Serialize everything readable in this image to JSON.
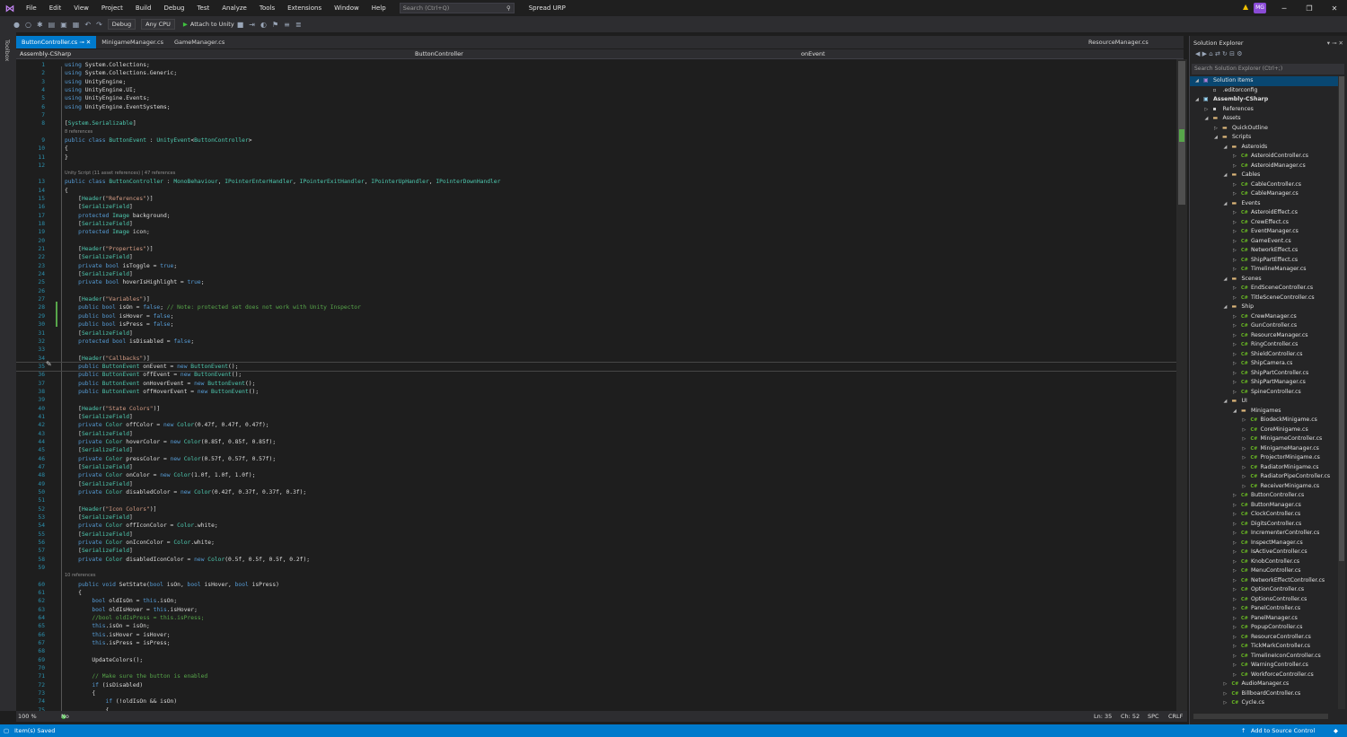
{
  "menubar": {
    "items": [
      "File",
      "Edit",
      "View",
      "Project",
      "Build",
      "Debug",
      "Test",
      "Analyze",
      "Tools",
      "Extensions",
      "Window",
      "Help"
    ],
    "search_placeholder": "Search (Ctrl+Q)",
    "solution_name": "Spread URP",
    "user_initials": "MG"
  },
  "toolbar": {
    "config": "Debug",
    "platform": "Any CPU",
    "attach_label": "Attach to Unity"
  },
  "left_strip": {
    "toolbox_label": "Toolbox"
  },
  "tabs": [
    {
      "label": "ButtonController.cs",
      "pin": "⊸",
      "close": "✕",
      "active": true
    },
    {
      "label": "MinigameManager.cs",
      "pin": "",
      "close": "",
      "active": false
    },
    {
      "label": "GameManager.cs",
      "pin": "",
      "close": "",
      "active": false
    }
  ],
  "tab_right": {
    "label": "ResourceManager.cs"
  },
  "navbar": {
    "project": "Assembly-CSharp",
    "class": "ButtonController",
    "member": "onEvent"
  },
  "code": [
    {
      "n": "1",
      "t": "using System.Collections;"
    },
    {
      "n": "2",
      "t": "using System.Collections.Generic;"
    },
    {
      "n": "3",
      "t": "using UnityEngine;"
    },
    {
      "n": "4",
      "t": "using UnityEngine.UI;"
    },
    {
      "n": "5",
      "t": "using UnityEngine.Events;"
    },
    {
      "n": "6",
      "t": "using UnityEngine.EventSystems;"
    },
    {
      "n": "7",
      "t": ""
    },
    {
      "n": "8",
      "t": "[System.Serializable]"
    },
    {
      "anno": "8 references"
    },
    {
      "n": "9",
      "t": "public class ButtonEvent : UnityEvent<ButtonController>"
    },
    {
      "n": "10",
      "t": "{"
    },
    {
      "n": "11",
      "t": "}"
    },
    {
      "n": "12",
      "t": ""
    },
    {
      "anno": "Unity Script (11 asset references) | 47 references"
    },
    {
      "n": "13",
      "t": "public class ButtonController : MonoBehaviour, IPointerEnterHandler, IPointerExitHandler, IPointerUpHandler, IPointerDownHandler"
    },
    {
      "n": "14",
      "t": "{"
    },
    {
      "n": "15",
      "t": "    [Header(\"References\")]"
    },
    {
      "n": "16",
      "t": "    [SerializeField]"
    },
    {
      "n": "17",
      "t": "    protected Image background;"
    },
    {
      "n": "18",
      "t": "    [SerializeField]"
    },
    {
      "n": "19",
      "t": "    protected Image icon;"
    },
    {
      "n": "20",
      "t": ""
    },
    {
      "n": "21",
      "t": "    [Header(\"Properties\")]"
    },
    {
      "n": "22",
      "t": "    [SerializeField]"
    },
    {
      "n": "23",
      "t": "    private bool isToggle = true;"
    },
    {
      "n": "24",
      "t": "    [SerializeField]"
    },
    {
      "n": "25",
      "t": "    private bool hoverIsHighlight = true;"
    },
    {
      "n": "26",
      "t": ""
    },
    {
      "n": "27",
      "t": "    [Header(\"Variables\")]"
    },
    {
      "n": "28",
      "t": "    public bool isOn = false; // Note: protected set does not work with Unity Inspector"
    },
    {
      "n": "29",
      "t": "    public bool isHover = false;"
    },
    {
      "n": "30",
      "t": "    public bool isPress = false;"
    },
    {
      "n": "31",
      "t": "    [SerializeField]"
    },
    {
      "n": "32",
      "t": "    protected bool isDisabled = false;"
    },
    {
      "n": "33",
      "t": ""
    },
    {
      "n": "34",
      "t": "    [Header(\"Callbacks\")]"
    },
    {
      "n": "35",
      "t": "    public ButtonEvent onEvent = new ButtonEvent();",
      "cur": true
    },
    {
      "n": "36",
      "t": "    public ButtonEvent offEvent = new ButtonEvent();"
    },
    {
      "n": "37",
      "t": "    public ButtonEvent onHoverEvent = new ButtonEvent();"
    },
    {
      "n": "38",
      "t": "    public ButtonEvent offHoverEvent = new ButtonEvent();"
    },
    {
      "n": "39",
      "t": ""
    },
    {
      "n": "40",
      "t": "    [Header(\"State Colors\")]"
    },
    {
      "n": "41",
      "t": "    [SerializeField]"
    },
    {
      "n": "42",
      "t": "    private Color offColor = new Color(0.47f, 0.47f, 0.47f);"
    },
    {
      "n": "43",
      "t": "    [SerializeField]"
    },
    {
      "n": "44",
      "t": "    private Color hoverColor = new Color(0.85f, 0.85f, 0.85f);"
    },
    {
      "n": "45",
      "t": "    [SerializeField]"
    },
    {
      "n": "46",
      "t": "    private Color pressColor = new Color(0.57f, 0.57f, 0.57f);"
    },
    {
      "n": "47",
      "t": "    [SerializeField]"
    },
    {
      "n": "48",
      "t": "    private Color onColor = new Color(1.0f, 1.0f, 1.0f);"
    },
    {
      "n": "49",
      "t": "    [SerializeField]"
    },
    {
      "n": "50",
      "t": "    private Color disabledColor = new Color(0.42f, 0.37f, 0.37f, 0.3f);"
    },
    {
      "n": "51",
      "t": ""
    },
    {
      "n": "52",
      "t": "    [Header(\"Icon Colors\")]"
    },
    {
      "n": "53",
      "t": "    [SerializeField]"
    },
    {
      "n": "54",
      "t": "    private Color offIconColor = Color.white;"
    },
    {
      "n": "55",
      "t": "    [SerializeField]"
    },
    {
      "n": "56",
      "t": "    private Color onIconColor = Color.white;"
    },
    {
      "n": "57",
      "t": "    [SerializeField]"
    },
    {
      "n": "58",
      "t": "    private Color disabledIconColor = new Color(0.5f, 0.5f, 0.5f, 0.2f);"
    },
    {
      "n": "59",
      "t": ""
    },
    {
      "anno": "10 references"
    },
    {
      "n": "60",
      "t": "    public void SetState(bool isOn, bool isHover, bool isPress)"
    },
    {
      "n": "61",
      "t": "    {"
    },
    {
      "n": "62",
      "t": "        bool oldIsOn = this.isOn;"
    },
    {
      "n": "63",
      "t": "        bool oldIsHover = this.isHover;"
    },
    {
      "n": "64",
      "t": "        //bool oldIsPress = this.isPress;"
    },
    {
      "n": "65",
      "t": "        this.isOn = isOn;"
    },
    {
      "n": "66",
      "t": "        this.isHover = isHover;"
    },
    {
      "n": "67",
      "t": "        this.isPress = isPress;"
    },
    {
      "n": "68",
      "t": ""
    },
    {
      "n": "69",
      "t": "        UpdateColors();"
    },
    {
      "n": "70",
      "t": ""
    },
    {
      "n": "71",
      "t": "        // Make sure the button is enabled"
    },
    {
      "n": "72",
      "t": "        if (isDisabled)"
    },
    {
      "n": "73",
      "t": "        {"
    },
    {
      "n": "74",
      "t": "            if (!oldIsOn && isOn)"
    },
    {
      "n": "75",
      "t": "            {"
    }
  ],
  "editor_status": {
    "zoom": "100 %",
    "issues": "No issues found",
    "line": "Ln: 35",
    "char": "Ch: 52",
    "spc": "SPC",
    "crlf": "CRLF"
  },
  "statusbar": {
    "left": "Item(s) Saved",
    "right": "Add to Source Control"
  },
  "explorer": {
    "title": "Solution Explorer",
    "search_placeholder": "Search Solution Explorer (Ctrl+;)",
    "tree": [
      {
        "d": 0,
        "arrow": "◢",
        "icon": "sln",
        "label": "Solution Items",
        "sel": true
      },
      {
        "d": 1,
        "arrow": "",
        "icon": "file",
        "label": ".editorconfig"
      },
      {
        "d": 0,
        "arrow": "◢",
        "icon": "proj",
        "label": "Assembly-CSharp",
        "bold": true
      },
      {
        "d": 1,
        "arrow": "▷",
        "icon": "ref",
        "label": "References"
      },
      {
        "d": 1,
        "arrow": "◢",
        "icon": "folder",
        "label": "Assets"
      },
      {
        "d": 2,
        "arrow": "▷",
        "icon": "folder",
        "label": "QuickOutline"
      },
      {
        "d": 2,
        "arrow": "◢",
        "icon": "folder",
        "label": "Scripts"
      },
      {
        "d": 3,
        "arrow": "◢",
        "icon": "folder",
        "label": "Asteroids"
      },
      {
        "d": 4,
        "arrow": "▷",
        "icon": "cs",
        "label": "AsteroidController.cs"
      },
      {
        "d": 4,
        "arrow": "▷",
        "icon": "cs",
        "label": "AsteroidManager.cs"
      },
      {
        "d": 3,
        "arrow": "◢",
        "icon": "folder",
        "label": "Cables"
      },
      {
        "d": 4,
        "arrow": "▷",
        "icon": "cs",
        "label": "CableController.cs"
      },
      {
        "d": 4,
        "arrow": "▷",
        "icon": "cs",
        "label": "CableManager.cs"
      },
      {
        "d": 3,
        "arrow": "◢",
        "icon": "folder",
        "label": "Events"
      },
      {
        "d": 4,
        "arrow": "▷",
        "icon": "cs",
        "label": "AsteroidEffect.cs"
      },
      {
        "d": 4,
        "arrow": "▷",
        "icon": "cs",
        "label": "CrewEffect.cs"
      },
      {
        "d": 4,
        "arrow": "▷",
        "icon": "cs",
        "label": "EventManager.cs"
      },
      {
        "d": 4,
        "arrow": "▷",
        "icon": "cs",
        "label": "GameEvent.cs"
      },
      {
        "d": 4,
        "arrow": "▷",
        "icon": "cs",
        "label": "NetworkEffect.cs"
      },
      {
        "d": 4,
        "arrow": "▷",
        "icon": "cs",
        "label": "ShipPartEffect.cs"
      },
      {
        "d": 4,
        "arrow": "▷",
        "icon": "cs",
        "label": "TimelineManager.cs"
      },
      {
        "d": 3,
        "arrow": "◢",
        "icon": "folder",
        "label": "Scenes"
      },
      {
        "d": 4,
        "arrow": "▷",
        "icon": "cs",
        "label": "EndSceneController.cs"
      },
      {
        "d": 4,
        "arrow": "▷",
        "icon": "cs",
        "label": "TitleSceneController.cs"
      },
      {
        "d": 3,
        "arrow": "◢",
        "icon": "folder",
        "label": "Ship"
      },
      {
        "d": 4,
        "arrow": "▷",
        "icon": "cs",
        "label": "CrewManager.cs"
      },
      {
        "d": 4,
        "arrow": "▷",
        "icon": "cs",
        "label": "GunController.cs"
      },
      {
        "d": 4,
        "arrow": "▷",
        "icon": "cs",
        "label": "ResourceManager.cs"
      },
      {
        "d": 4,
        "arrow": "▷",
        "icon": "cs",
        "label": "RingController.cs"
      },
      {
        "d": 4,
        "arrow": "▷",
        "icon": "cs",
        "label": "ShieldController.cs"
      },
      {
        "d": 4,
        "arrow": "▷",
        "icon": "cs",
        "label": "ShipCamera.cs"
      },
      {
        "d": 4,
        "arrow": "▷",
        "icon": "cs",
        "label": "ShipPartController.cs"
      },
      {
        "d": 4,
        "arrow": "▷",
        "icon": "cs",
        "label": "ShipPartManager.cs"
      },
      {
        "d": 4,
        "arrow": "▷",
        "icon": "cs",
        "label": "SpineController.cs"
      },
      {
        "d": 3,
        "arrow": "◢",
        "icon": "folder",
        "label": "UI"
      },
      {
        "d": 4,
        "arrow": "◢",
        "icon": "folder",
        "label": "Minigames"
      },
      {
        "d": 5,
        "arrow": "▷",
        "icon": "cs",
        "label": "BiodeckMinigame.cs"
      },
      {
        "d": 5,
        "arrow": "▷",
        "icon": "cs",
        "label": "CoreMinigame.cs"
      },
      {
        "d": 5,
        "arrow": "▷",
        "icon": "cs",
        "label": "MinigameController.cs"
      },
      {
        "d": 5,
        "arrow": "▷",
        "icon": "cs",
        "label": "MinigameManager.cs"
      },
      {
        "d": 5,
        "arrow": "▷",
        "icon": "cs",
        "label": "ProjectorMinigame.cs"
      },
      {
        "d": 5,
        "arrow": "▷",
        "icon": "cs",
        "label": "RadiatorMinigame.cs"
      },
      {
        "d": 5,
        "arrow": "▷",
        "icon": "cs",
        "label": "RadiatorPipeController.cs"
      },
      {
        "d": 5,
        "arrow": "▷",
        "icon": "cs",
        "label": "ReceiverMinigame.cs"
      },
      {
        "d": 4,
        "arrow": "▷",
        "icon": "cs",
        "label": "ButtonController.cs"
      },
      {
        "d": 4,
        "arrow": "▷",
        "icon": "cs",
        "label": "ButtonManager.cs"
      },
      {
        "d": 4,
        "arrow": "▷",
        "icon": "cs",
        "label": "ClockController.cs"
      },
      {
        "d": 4,
        "arrow": "▷",
        "icon": "cs",
        "label": "DigitsController.cs"
      },
      {
        "d": 4,
        "arrow": "▷",
        "icon": "cs",
        "label": "IncrementerController.cs"
      },
      {
        "d": 4,
        "arrow": "▷",
        "icon": "cs",
        "label": "InspectManager.cs"
      },
      {
        "d": 4,
        "arrow": "▷",
        "icon": "cs",
        "label": "IsActiveController.cs"
      },
      {
        "d": 4,
        "arrow": "▷",
        "icon": "cs",
        "label": "KnobController.cs"
      },
      {
        "d": 4,
        "arrow": "▷",
        "icon": "cs",
        "label": "MenuController.cs"
      },
      {
        "d": 4,
        "arrow": "▷",
        "icon": "cs",
        "label": "NetworkEffectController.cs"
      },
      {
        "d": 4,
        "arrow": "▷",
        "icon": "cs",
        "label": "OptionController.cs"
      },
      {
        "d": 4,
        "arrow": "▷",
        "icon": "cs",
        "label": "OptionsController.cs"
      },
      {
        "d": 4,
        "arrow": "▷",
        "icon": "cs",
        "label": "PanelController.cs"
      },
      {
        "d": 4,
        "arrow": "▷",
        "icon": "cs",
        "label": "PanelManager.cs"
      },
      {
        "d": 4,
        "arrow": "▷",
        "icon": "cs",
        "label": "PopupController.cs"
      },
      {
        "d": 4,
        "arrow": "▷",
        "icon": "cs",
        "label": "ResourceController.cs"
      },
      {
        "d": 4,
        "arrow": "▷",
        "icon": "cs",
        "label": "TickMarkController.cs"
      },
      {
        "d": 4,
        "arrow": "▷",
        "icon": "cs",
        "label": "TimelineIconController.cs"
      },
      {
        "d": 4,
        "arrow": "▷",
        "icon": "cs",
        "label": "WarningController.cs"
      },
      {
        "d": 4,
        "arrow": "▷",
        "icon": "cs",
        "label": "WorkforceController.cs"
      },
      {
        "d": 3,
        "arrow": "▷",
        "icon": "cs",
        "label": "AudioManager.cs"
      },
      {
        "d": 3,
        "arrow": "▷",
        "icon": "cs",
        "label": "BillboardController.cs"
      },
      {
        "d": 3,
        "arrow": "▷",
        "icon": "cs",
        "label": "Cycle.cs"
      }
    ]
  }
}
